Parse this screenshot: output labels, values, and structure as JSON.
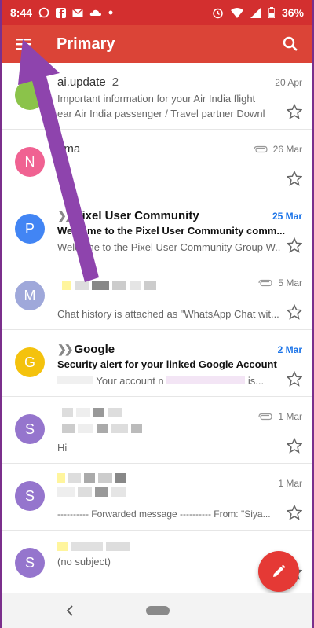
{
  "status_bar": {
    "time": "8:44",
    "battery": "36%"
  },
  "app_bar": {
    "title": "Primary"
  },
  "emails": [
    {
      "avatar_letter": "",
      "avatar_color": "#8bc34a",
      "sender": "ai.update",
      "count": "2",
      "date": "20 Apr",
      "subject": "",
      "snippet": "Important information for your Air India flight",
      "snippet2": "ear Air India passenger / Travel partner Downl",
      "unread": false,
      "attachment": false
    },
    {
      "avatar_letter": "N",
      "avatar_color": "#f06292",
      "sender": "oma",
      "count": "",
      "date": "26 Mar",
      "subject": "",
      "snippet": "",
      "snippet2": "",
      "unread": false,
      "attachment": true
    },
    {
      "avatar_letter": "P",
      "avatar_color": "#4285f4",
      "sender": "Pixel User Community",
      "count": "",
      "date": "25 Mar",
      "subject": "Welcome to the Pixel User Community comm...",
      "snippet": "Welcome to the Pixel User Community Group W...",
      "unread": true,
      "attachment": false
    },
    {
      "avatar_letter": "M",
      "avatar_color": "#9fa8da",
      "sender": "",
      "count": "",
      "date": "5 Mar",
      "subject": "",
      "snippet": "Chat history is attached as \"WhatsApp Chat wit...",
      "unread": false,
      "attachment": true
    },
    {
      "avatar_letter": "G",
      "avatar_color": "#f4c20d",
      "sender": "Google",
      "count": "",
      "date": "2 Mar",
      "subject": "Security alert for your linked Google Account",
      "snippet": "Your account n",
      "snippet_end": "is...",
      "unread": true,
      "attachment": false
    },
    {
      "avatar_letter": "S",
      "avatar_color": "#9575cd",
      "sender": "",
      "count": "",
      "date": "1 Mar",
      "subject": "",
      "snippet": "Hi",
      "unread": false,
      "attachment": true
    },
    {
      "avatar_letter": "S",
      "avatar_color": "#9575cd",
      "sender": "",
      "count": "",
      "date": "1 Mar",
      "subject": "",
      "snippet": "---------- Forwarded message ---------- From: \"Siya...",
      "unread": false,
      "attachment": false
    },
    {
      "avatar_letter": "S",
      "avatar_color": "#9575cd",
      "sender": "",
      "count": "",
      "date": "",
      "subject": "",
      "snippet": "(no subject)",
      "unread": false,
      "attachment": false
    }
  ],
  "colors": {
    "status_bar": "#d32f2f",
    "app_bar": "#db4437",
    "fab": "#e53935",
    "arrow": "#8e44ad",
    "unread_date": "#1a73e8"
  },
  "icons": {
    "menu": "menu-icon",
    "search": "search-icon",
    "star": "star-outline-icon",
    "compose": "pencil-icon",
    "attachment": "paperclip-icon",
    "back": "back-chevron-icon"
  }
}
